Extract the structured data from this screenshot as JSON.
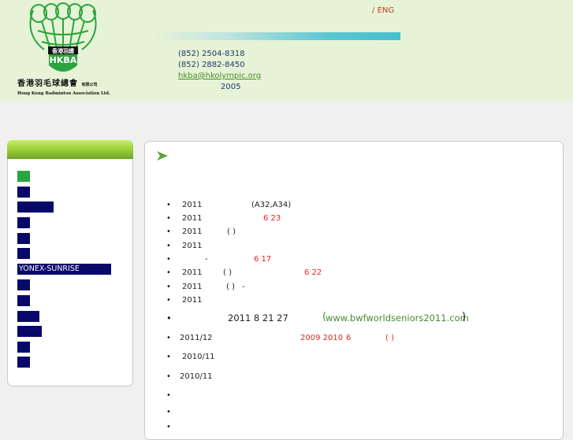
{
  "header": {
    "logo": {
      "badge_text": "HKBA",
      "band_text": "香港羽總",
      "name_cn": "香港羽毛球總會",
      "name_cn_suffix": "有限公司",
      "name_en": "Hong Kong Badminton Association Ltd."
    },
    "lang": {
      "separator": "/",
      "eng_label": "ENG"
    },
    "contact": {
      "phone": "(852) 2504-8318",
      "fax": "(852) 2882-8450",
      "email": "hkba@hkolympic.org",
      "year": "2005"
    }
  },
  "sidebar": {
    "items": [
      {
        "label": "",
        "active": true
      },
      {
        "label": "",
        "active": false
      },
      {
        "label": "",
        "active": false
      },
      {
        "label": "",
        "active": false
      },
      {
        "label": "",
        "active": false
      },
      {
        "label": "",
        "active": false
      },
      {
        "label": "YONEX-SUNRISE",
        "active": false
      },
      {
        "label": "",
        "active": false
      },
      {
        "label": "",
        "active": false
      },
      {
        "label": "",
        "active": false
      },
      {
        "label": "",
        "active": false
      },
      {
        "label": "",
        "active": false
      },
      {
        "label": "",
        "active": false
      }
    ]
  },
  "main": {
    "bullet": "•",
    "news": [
      {
        "parts": [
          {
            "text": "2011"
          },
          {
            "text": "(A32,A34)"
          }
        ]
      },
      {
        "parts": [
          {
            "text": "2011"
          },
          {
            "text": "6 23",
            "red": true
          }
        ]
      },
      {
        "parts": [
          {
            "text": "2011"
          },
          {
            "text": "( )"
          }
        ]
      },
      {
        "parts": [
          {
            "text": "2011"
          }
        ]
      },
      {
        "parts": [
          {
            "text": "-"
          },
          {
            "text": "6 17",
            "red": true
          }
        ]
      },
      {
        "parts": [
          {
            "text": "2011"
          },
          {
            "text": "(   )"
          },
          {
            "text": "6 22",
            "red": true
          }
        ]
      },
      {
        "parts": [
          {
            "text": "2011"
          },
          {
            "text": "( )"
          },
          {
            "text": "-"
          }
        ]
      },
      {
        "parts": [
          {
            "text": "2011"
          }
        ]
      },
      {
        "parts": [
          {
            "text": "2011 8 21 27"
          },
          {
            "text": "(",
            "green": true
          },
          {
            "text": "www.bwfworldseniors2011.com",
            "green": true
          },
          {
            "text": ")"
          }
        ]
      },
      {
        "parts": [
          {
            "text": "2011/12"
          },
          {
            "text": "2009 2010",
            "red": true
          },
          {
            "text": "6",
            "red": true
          },
          {
            "text": "(     )",
            "red": true
          }
        ]
      },
      {
        "parts": [
          {
            "text": "2010/11"
          }
        ]
      },
      {
        "parts": [
          {
            "text": "2010/11"
          }
        ]
      },
      {
        "parts": []
      },
      {
        "parts": []
      },
      {
        "parts": []
      }
    ]
  }
}
